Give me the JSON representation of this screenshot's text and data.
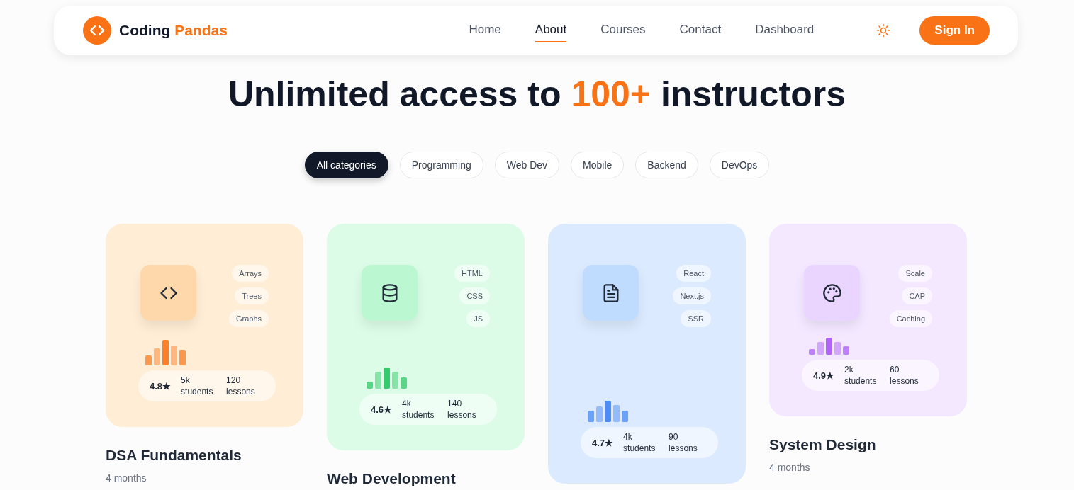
{
  "brand": {
    "first": "Coding",
    "second": "Pandas"
  },
  "nav": [
    {
      "label": "Home",
      "selected": false
    },
    {
      "label": "About",
      "selected": true
    },
    {
      "label": "Courses",
      "selected": false
    },
    {
      "label": "Contact",
      "selected": false
    },
    {
      "label": "Dashboard",
      "selected": false
    }
  ],
  "sign_in": "Sign In",
  "heading": {
    "before": "Unlimited access to ",
    "highlight": "100+",
    "after": " instructors"
  },
  "categories": [
    {
      "label": "All categories",
      "selected": true
    },
    {
      "label": "Programming",
      "selected": false
    },
    {
      "label": "Web Dev",
      "selected": false
    },
    {
      "label": "Mobile",
      "selected": false
    },
    {
      "label": "Backend",
      "selected": false
    },
    {
      "label": "DevOps",
      "selected": false
    }
  ],
  "courses": [
    {
      "kind": "code",
      "color": "#ffedd5",
      "tags": [
        "Arrays",
        "Trees",
        "Graphs"
      ],
      "rating": "4.8★",
      "students_count": "5k",
      "students_label": "students",
      "lessons_count": "120",
      "lessons_label": "lessons",
      "title": "DSA Fundamentals",
      "duration": "4 months"
    },
    {
      "kind": "database",
      "color": "#dcfce7",
      "tags": [
        "HTML",
        "CSS",
        "JS"
      ],
      "rating": "4.6★",
      "students_count": "4k",
      "students_label": "students",
      "lessons_count": "140",
      "lessons_label": "lessons",
      "title": "Web Development"
    },
    {
      "kind": "document",
      "color": "#dbeafe",
      "tags": [
        "React",
        "Next.js",
        "SSR"
      ],
      "rating": "4.7★",
      "students_count": "4k",
      "students_label": "students",
      "lessons_count": "90",
      "lessons_label": "lessons"
    },
    {
      "kind": "palette",
      "color": "#f3e8ff",
      "tags": [
        "Scale",
        "CAP",
        "Caching"
      ],
      "rating": "4.9★",
      "students_count": "2k",
      "students_label": "students",
      "lessons_count": "60",
      "lessons_label": "lessons",
      "title": "System Design",
      "duration": "4 months"
    }
  ]
}
